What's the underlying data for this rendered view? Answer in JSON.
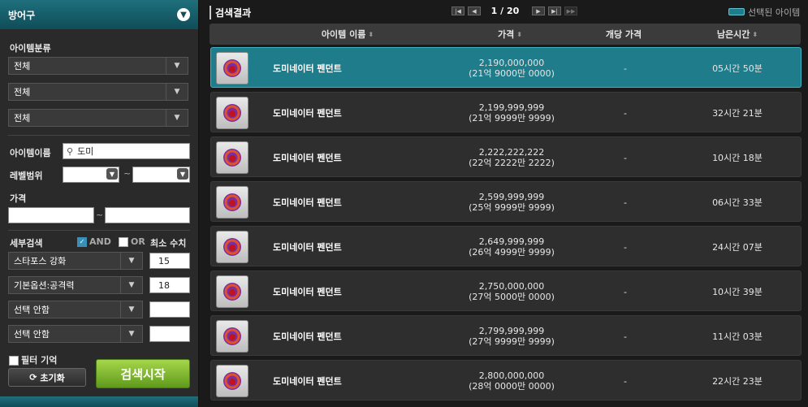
{
  "sidebar": {
    "title": "방어구",
    "category_label": "아이템분류",
    "category_selects": [
      "전체",
      "전체",
      "전체"
    ],
    "name_label": "아이템이름",
    "name_value": "도미",
    "level_label": "레벨범위",
    "level_sep": "~",
    "price_label": "가격",
    "price_sep": "~",
    "detail_label": "세부검색",
    "and_label": "AND",
    "or_label": "OR",
    "min_label": "최소 수치",
    "detail_rows": [
      {
        "option": "스타포스 강화",
        "value": "15"
      },
      {
        "option": "기본옵션:공격력",
        "value": "18"
      },
      {
        "option": "선택 안함",
        "value": ""
      },
      {
        "option": "선택 안함",
        "value": ""
      }
    ],
    "remember_label": "필터 기억",
    "reset_label": "초기화",
    "search_label": "검색시작"
  },
  "results": {
    "title": "검색결과",
    "page": "1 / 20",
    "selected_legend": "선택된 아이템",
    "columns": {
      "name": "아이템 이름",
      "price": "가격",
      "unit_price": "개당 가격",
      "time_left": "남은시간"
    },
    "rows": [
      {
        "name": "도미네이터 펜던트",
        "price": "2,190,000,000",
        "price_kr": "(21억 9000만 0000)",
        "unit": "-",
        "time": "05시간 50분"
      },
      {
        "name": "도미네이터 펜던트",
        "price": "2,199,999,999",
        "price_kr": "(21억 9999만 9999)",
        "unit": "-",
        "time": "32시간 21분"
      },
      {
        "name": "도미네이터 펜던트",
        "price": "2,222,222,222",
        "price_kr": "(22억 2222만 2222)",
        "unit": "-",
        "time": "10시간 18분"
      },
      {
        "name": "도미네이터 펜던트",
        "price": "2,599,999,999",
        "price_kr": "(25억 9999만 9999)",
        "unit": "-",
        "time": "06시간 33분"
      },
      {
        "name": "도미네이터 펜던트",
        "price": "2,649,999,999",
        "price_kr": "(26억 4999만 9999)",
        "unit": "-",
        "time": "24시간 07분"
      },
      {
        "name": "도미네이터 펜던트",
        "price": "2,750,000,000",
        "price_kr": "(27억 5000만 0000)",
        "unit": "-",
        "time": "10시간 39분"
      },
      {
        "name": "도미네이터 펜던트",
        "price": "2,799,999,999",
        "price_kr": "(27억 9999만 9999)",
        "unit": "-",
        "time": "11시간 03분"
      },
      {
        "name": "도미네이터 펜던트",
        "price": "2,800,000,000",
        "price_kr": "(28억 0000만 0000)",
        "unit": "-",
        "time": "22시간 23분"
      }
    ]
  },
  "colors": {
    "accent": "#1f7c8a",
    "search_button": "#7fb82e"
  }
}
